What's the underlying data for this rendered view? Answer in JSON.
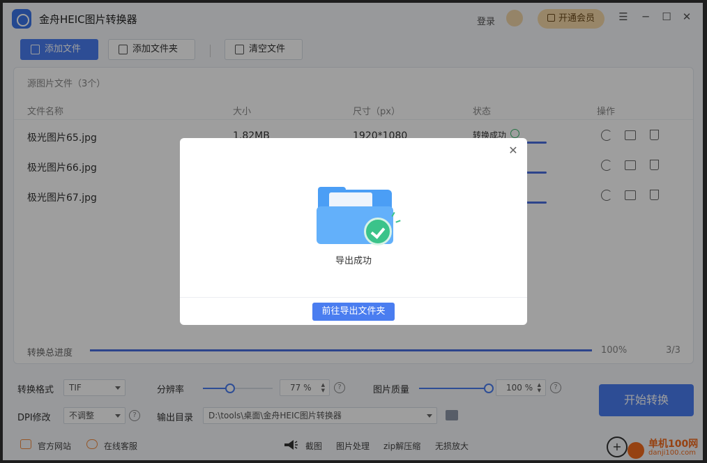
{
  "app": {
    "title": "金舟HEIC图片转换器",
    "login": "登录",
    "vip_button": "开通会员"
  },
  "toolbar": {
    "add_file": "添加文件",
    "add_folder": "添加文件夹",
    "clear_files": "清空文件"
  },
  "file_list": {
    "header": "源图片文件（3个）",
    "columns": {
      "name": "文件名称",
      "size": "大小",
      "dimensions": "尺寸（px）",
      "status": "状态",
      "actions": "操作"
    },
    "rows": [
      {
        "name": "极光图片65.jpg",
        "size": "1.82MB",
        "dimensions": "1920*1080",
        "status": "转换成功"
      },
      {
        "name": "极光图片66.jpg"
      },
      {
        "name": "极光图片67.jpg"
      }
    ]
  },
  "progress": {
    "label": "转换总进度",
    "percent": "100%",
    "count": "3/3",
    "fraction": 1.0
  },
  "settings": {
    "format_label": "转换格式",
    "format_value": "TIF",
    "resolution_label": "分辨率",
    "resolution_value": "77 %",
    "resolution_fraction": 0.39,
    "quality_label": "图片质量",
    "quality_value": "100 %",
    "quality_fraction": 1.0,
    "dpi_label": "DPI修改",
    "dpi_value": "不调整",
    "output_label": "输出目录",
    "output_value": "D:\\tools\\桌面\\金舟HEIC图片转换器",
    "start_button": "开始转换",
    "help": "?"
  },
  "footer": {
    "website": "官方网站",
    "support": "在线客服",
    "screenshot": "截图",
    "image_processing": "图片处理",
    "zip": "zip解压缩",
    "upscale": "无损放大"
  },
  "watermark": {
    "text": "单机100网",
    "sub": "danji100.com"
  },
  "dialog": {
    "message": "导出成功",
    "button": "前往导出文件夹"
  },
  "colors": {
    "accent": "#4a7df0",
    "success": "#3bc38a",
    "vip": "#f5d9a8"
  }
}
